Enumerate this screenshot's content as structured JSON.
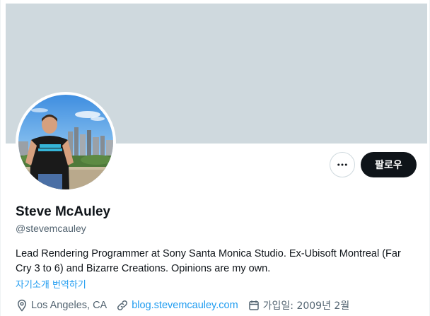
{
  "profile": {
    "display_name": "Steve McAuley",
    "handle": "@stevemcauley",
    "bio": "Lead Rendering Programmer at Sony Santa Monica Studio. Ex-Ubisoft Montreal (Far Cry 3 to 6) and Bizarre Creations. Opinions are my own.",
    "translate_bio": "자기소개 번역하기",
    "location": "Los Angeles, CA",
    "website": "blog.stevemcauley.com",
    "joined": "가입일: 2009년 2월"
  },
  "actions": {
    "follow_label": "팔로우",
    "more_icon": "more-icon"
  },
  "colors": {
    "banner": "#cfd9de",
    "link": "#1d9bf0",
    "follow_bg": "#0f1419",
    "muted_text": "#536471"
  }
}
